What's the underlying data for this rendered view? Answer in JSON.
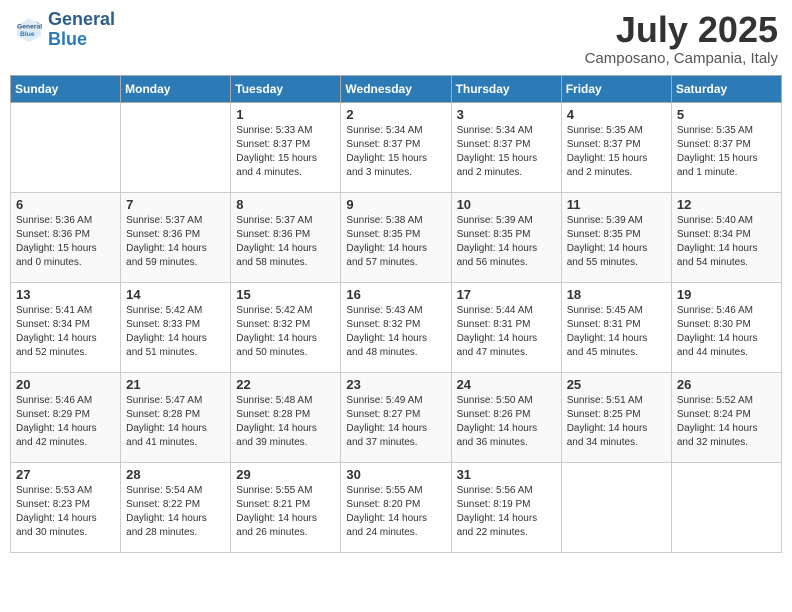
{
  "header": {
    "logo_line1": "General",
    "logo_line2": "Blue",
    "month_title": "July 2025",
    "location": "Camposano, Campania, Italy"
  },
  "weekdays": [
    "Sunday",
    "Monday",
    "Tuesday",
    "Wednesday",
    "Thursday",
    "Friday",
    "Saturday"
  ],
  "weeks": [
    [
      {
        "day": "",
        "info": ""
      },
      {
        "day": "",
        "info": ""
      },
      {
        "day": "1",
        "info": "Sunrise: 5:33 AM\nSunset: 8:37 PM\nDaylight: 15 hours and 4 minutes."
      },
      {
        "day": "2",
        "info": "Sunrise: 5:34 AM\nSunset: 8:37 PM\nDaylight: 15 hours and 3 minutes."
      },
      {
        "day": "3",
        "info": "Sunrise: 5:34 AM\nSunset: 8:37 PM\nDaylight: 15 hours and 2 minutes."
      },
      {
        "day": "4",
        "info": "Sunrise: 5:35 AM\nSunset: 8:37 PM\nDaylight: 15 hours and 2 minutes."
      },
      {
        "day": "5",
        "info": "Sunrise: 5:35 AM\nSunset: 8:37 PM\nDaylight: 15 hours and 1 minute."
      }
    ],
    [
      {
        "day": "6",
        "info": "Sunrise: 5:36 AM\nSunset: 8:36 PM\nDaylight: 15 hours and 0 minutes."
      },
      {
        "day": "7",
        "info": "Sunrise: 5:37 AM\nSunset: 8:36 PM\nDaylight: 14 hours and 59 minutes."
      },
      {
        "day": "8",
        "info": "Sunrise: 5:37 AM\nSunset: 8:36 PM\nDaylight: 14 hours and 58 minutes."
      },
      {
        "day": "9",
        "info": "Sunrise: 5:38 AM\nSunset: 8:35 PM\nDaylight: 14 hours and 57 minutes."
      },
      {
        "day": "10",
        "info": "Sunrise: 5:39 AM\nSunset: 8:35 PM\nDaylight: 14 hours and 56 minutes."
      },
      {
        "day": "11",
        "info": "Sunrise: 5:39 AM\nSunset: 8:35 PM\nDaylight: 14 hours and 55 minutes."
      },
      {
        "day": "12",
        "info": "Sunrise: 5:40 AM\nSunset: 8:34 PM\nDaylight: 14 hours and 54 minutes."
      }
    ],
    [
      {
        "day": "13",
        "info": "Sunrise: 5:41 AM\nSunset: 8:34 PM\nDaylight: 14 hours and 52 minutes."
      },
      {
        "day": "14",
        "info": "Sunrise: 5:42 AM\nSunset: 8:33 PM\nDaylight: 14 hours and 51 minutes."
      },
      {
        "day": "15",
        "info": "Sunrise: 5:42 AM\nSunset: 8:32 PM\nDaylight: 14 hours and 50 minutes."
      },
      {
        "day": "16",
        "info": "Sunrise: 5:43 AM\nSunset: 8:32 PM\nDaylight: 14 hours and 48 minutes."
      },
      {
        "day": "17",
        "info": "Sunrise: 5:44 AM\nSunset: 8:31 PM\nDaylight: 14 hours and 47 minutes."
      },
      {
        "day": "18",
        "info": "Sunrise: 5:45 AM\nSunset: 8:31 PM\nDaylight: 14 hours and 45 minutes."
      },
      {
        "day": "19",
        "info": "Sunrise: 5:46 AM\nSunset: 8:30 PM\nDaylight: 14 hours and 44 minutes."
      }
    ],
    [
      {
        "day": "20",
        "info": "Sunrise: 5:46 AM\nSunset: 8:29 PM\nDaylight: 14 hours and 42 minutes."
      },
      {
        "day": "21",
        "info": "Sunrise: 5:47 AM\nSunset: 8:28 PM\nDaylight: 14 hours and 41 minutes."
      },
      {
        "day": "22",
        "info": "Sunrise: 5:48 AM\nSunset: 8:28 PM\nDaylight: 14 hours and 39 minutes."
      },
      {
        "day": "23",
        "info": "Sunrise: 5:49 AM\nSunset: 8:27 PM\nDaylight: 14 hours and 37 minutes."
      },
      {
        "day": "24",
        "info": "Sunrise: 5:50 AM\nSunset: 8:26 PM\nDaylight: 14 hours and 36 minutes."
      },
      {
        "day": "25",
        "info": "Sunrise: 5:51 AM\nSunset: 8:25 PM\nDaylight: 14 hours and 34 minutes."
      },
      {
        "day": "26",
        "info": "Sunrise: 5:52 AM\nSunset: 8:24 PM\nDaylight: 14 hours and 32 minutes."
      }
    ],
    [
      {
        "day": "27",
        "info": "Sunrise: 5:53 AM\nSunset: 8:23 PM\nDaylight: 14 hours and 30 minutes."
      },
      {
        "day": "28",
        "info": "Sunrise: 5:54 AM\nSunset: 8:22 PM\nDaylight: 14 hours and 28 minutes."
      },
      {
        "day": "29",
        "info": "Sunrise: 5:55 AM\nSunset: 8:21 PM\nDaylight: 14 hours and 26 minutes."
      },
      {
        "day": "30",
        "info": "Sunrise: 5:55 AM\nSunset: 8:20 PM\nDaylight: 14 hours and 24 minutes."
      },
      {
        "day": "31",
        "info": "Sunrise: 5:56 AM\nSunset: 8:19 PM\nDaylight: 14 hours and 22 minutes."
      },
      {
        "day": "",
        "info": ""
      },
      {
        "day": "",
        "info": ""
      }
    ]
  ]
}
